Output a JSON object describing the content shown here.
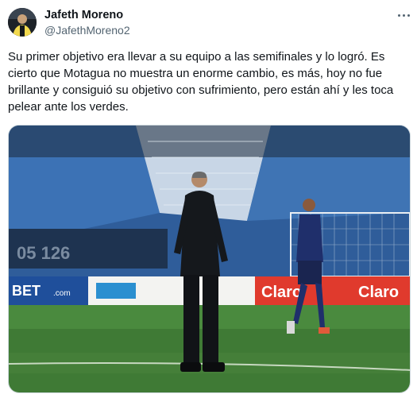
{
  "author": {
    "name": "Jafeth Moreno",
    "handle": "@JafethMoreno2",
    "avatar_icon": "profile-photo-icon"
  },
  "menu_icon": "more-options-icon",
  "tweet": {
    "text": "Su primer objetivo era llevar a su equipo a las semifinales y lo logró. Es cierto que Motagua no muestra un enorme cambio, es más, hoy no fue brillante y consiguió su objetivo con sufrimiento, pero están ahí y les toca pelear ante los verdes."
  },
  "photo": {
    "ad_boards": [
      "BET",
      ".com",
      "Claro",
      "Claro"
    ]
  },
  "colors": {
    "name": "#0f1419",
    "handle": "#536471",
    "pitch": "#3f7a35",
    "stands": "#2f5d9a"
  }
}
